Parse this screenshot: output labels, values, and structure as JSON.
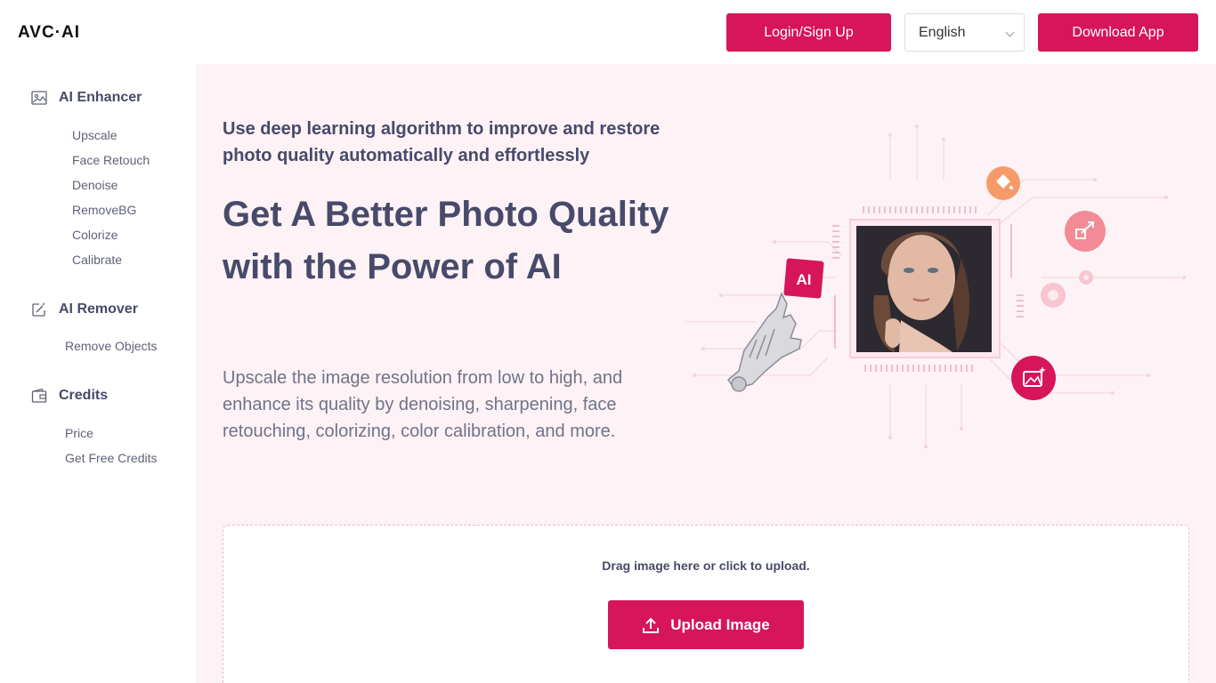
{
  "header": {
    "logo_text": "AVC·AI",
    "login_label": "Login/Sign Up",
    "language": "English",
    "download_label": "Download App"
  },
  "sidebar": {
    "sections": [
      {
        "title": "AI Enhancer",
        "icon": "image-icon",
        "items": [
          "Upscale",
          "Face Retouch",
          "Denoise",
          "RemoveBG",
          "Colorize",
          "Calibrate"
        ]
      },
      {
        "title": "AI Remover",
        "icon": "magic-edit-icon",
        "items": [
          "Remove Objects"
        ]
      },
      {
        "title": "Credits",
        "icon": "wallet-icon",
        "items": [
          "Price",
          "Get Free Credits"
        ]
      }
    ]
  },
  "hero": {
    "tagline": "Use deep learning algorithm to improve and restore photo quality automatically and effortlessly",
    "headline": "Get A Better Photo Quality with the Power of AI",
    "description": "Upscale the image resolution from low to high, and enhance its quality by denoising, sharpening, face retouching, colorizing, color calibration, and more.",
    "ai_badge": "AI"
  },
  "upload": {
    "hint": "Drag image here or click to upload.",
    "button_label": "Upload Image"
  },
  "colors": {
    "accent": "#d6155a",
    "hero_bg": "#fdf2f5",
    "text": "#474a6a"
  }
}
